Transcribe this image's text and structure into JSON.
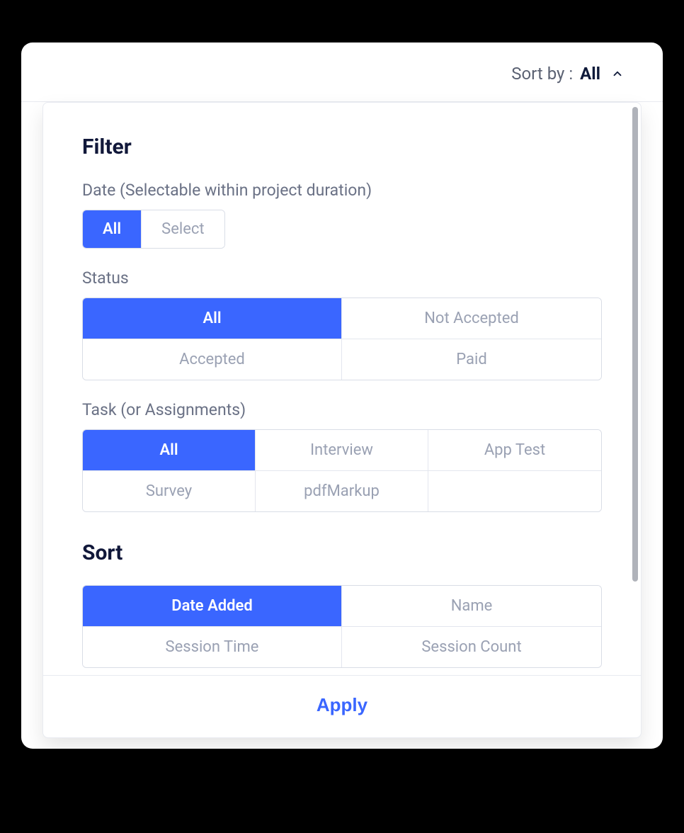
{
  "header": {
    "sort_by_label": "Sort by :",
    "sort_by_value": "All"
  },
  "panel": {
    "filter_title": "Filter",
    "date": {
      "label": "Date (Selectable within project duration)",
      "options": [
        "All",
        "Select"
      ],
      "selected": "All"
    },
    "status": {
      "label": "Status",
      "options": [
        "All",
        "Not Accepted",
        "Accepted",
        "Paid"
      ],
      "selected": "All"
    },
    "task": {
      "label": "Task (or Assignments)",
      "options": [
        "All",
        "Interview",
        "App Test",
        "Survey",
        "pdfMarkup"
      ],
      "selected": "All"
    },
    "sort_title": "Sort",
    "sort_options": {
      "options": [
        "Date Added",
        "Name",
        "Session Time",
        "Session Count"
      ],
      "selected": "Date Added"
    },
    "apply_label": "Apply"
  }
}
